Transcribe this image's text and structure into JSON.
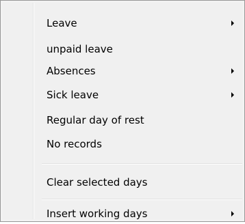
{
  "menu": {
    "items": [
      {
        "label": "Leave",
        "has_submenu": true
      },
      {
        "label": "unpaid leave",
        "has_submenu": false
      },
      {
        "label": "Absences",
        "has_submenu": true
      },
      {
        "label": "Sick leave",
        "has_submenu": true
      },
      {
        "label": "Regular day of rest",
        "has_submenu": false
      },
      {
        "label": "No records",
        "has_submenu": false
      },
      {
        "label": "Clear selected days",
        "has_submenu": false
      },
      {
        "label": "Insert working days",
        "has_submenu": true
      }
    ],
    "submenu_arrow_icon": "chevron-right-icon"
  }
}
